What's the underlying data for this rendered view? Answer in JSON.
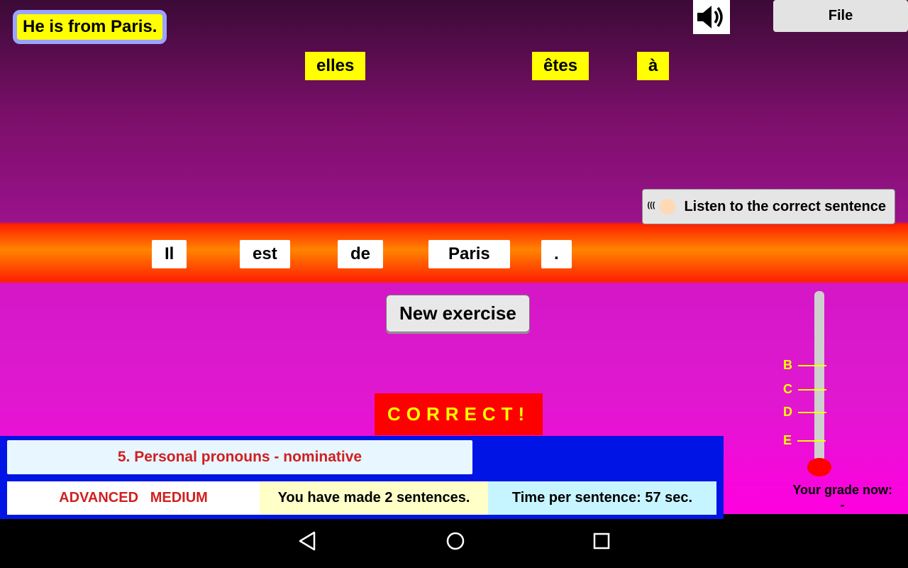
{
  "prompt": "He is from Paris.",
  "fileLabel": "File",
  "pool": [
    "elles",
    "êtes",
    "à"
  ],
  "answer": [
    "Il",
    "est",
    "de",
    "Paris",
    "."
  ],
  "listenLabel": "Listen to the correct sentence",
  "newExerciseLabel": "New exercise",
  "feedback": "CORRECT!",
  "lesson": "5. Personal pronouns - nominative",
  "level1": "ADVANCED",
  "level2": "MEDIUM",
  "progress": "You have made 2 sentences.",
  "pace": "Time per sentence: 57 sec.",
  "thermo": {
    "ticks": [
      "B",
      "C",
      "D",
      "E"
    ]
  },
  "gradeLabel": "Your grade now:",
  "gradeValue": "-"
}
